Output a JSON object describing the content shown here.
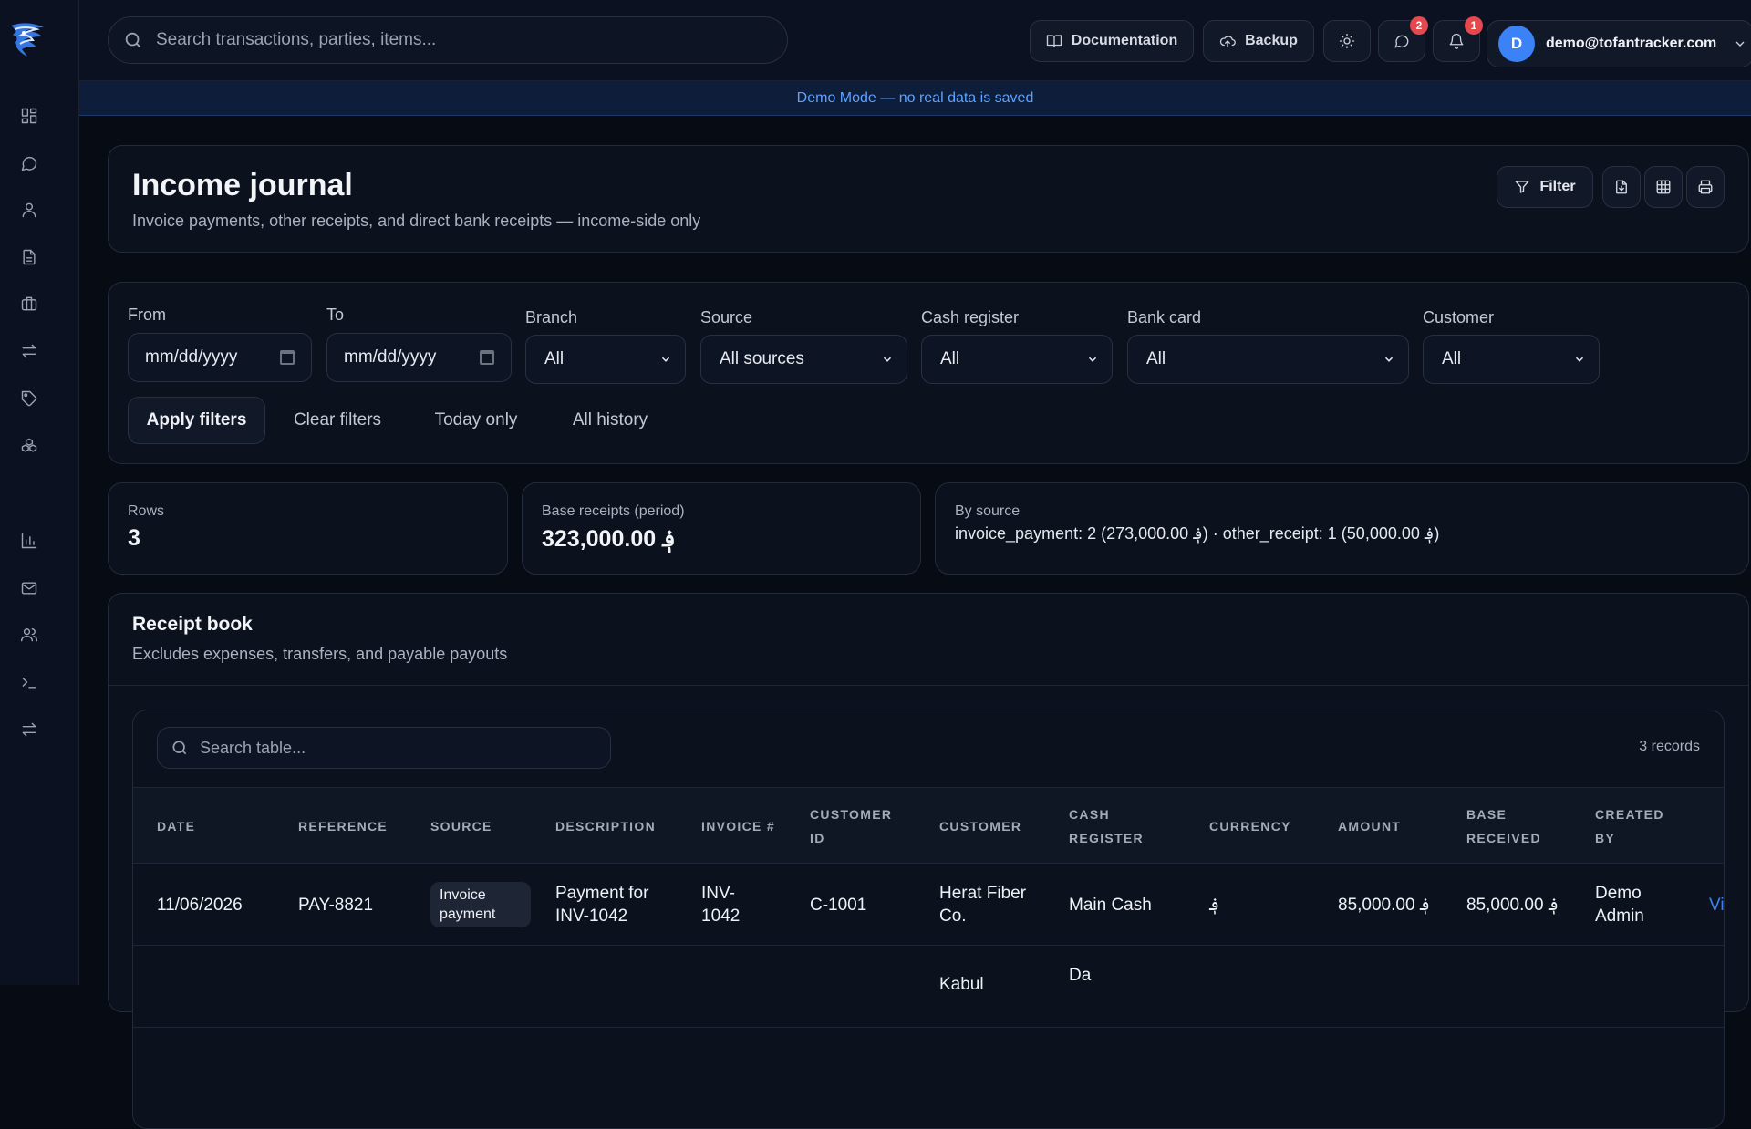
{
  "topbar": {
    "search_placeholder": "Search transactions, parties, items...",
    "documentation_label": "Documentation",
    "backup_label": "Backup",
    "messages_badge": "2",
    "notifications_badge": "1",
    "user_initial": "D",
    "user_email": "demo@tofantracker.com"
  },
  "demo_banner": "Demo Mode — no real data is saved",
  "header": {
    "title": "Income journal",
    "subtitle": "Invoice payments, other receipts, and direct bank receipts — income-side only",
    "filter_label": "Filter"
  },
  "filters": {
    "from_label": "From",
    "from_value": "mm/dd/yyyy",
    "to_label": "To",
    "to_value": "mm/dd/yyyy",
    "branch_label": "Branch",
    "branch_value": "All",
    "source_label": "Source",
    "source_value": "All sources",
    "cash_register_label": "Cash register",
    "cash_register_value": "All",
    "bank_card_label": "Bank card",
    "bank_card_value": "All",
    "customer_label": "Customer",
    "customer_value": "All",
    "apply_label": "Apply filters",
    "clear_label": "Clear filters",
    "today_label": "Today only",
    "history_label": "All history"
  },
  "stats": {
    "rows_label": "Rows",
    "rows_value": "3",
    "base_label": "Base receipts (period)",
    "base_value": "323,000.00 ؋",
    "source_label": "By source",
    "source_value": "invoice_payment: 2 (273,000.00 ؋) · other_receipt: 1 (50,000.00 ؋)"
  },
  "receipt_book": {
    "title": "Receipt book",
    "subtitle": "Excludes expenses, transfers, and payable payouts",
    "search_placeholder": "Search table...",
    "records": "3 records"
  },
  "table": {
    "headers": [
      "DATE",
      "REFERENCE",
      "SOURCE",
      "DESCRIPTION",
      "INVOICE #",
      "CUSTOMER ID",
      "CUSTOMER",
      "CASH REGISTER",
      "CURRENCY",
      "AMOUNT",
      "BASE RECEIVED",
      "CREATED BY"
    ],
    "rows": [
      {
        "date": "11/06/2026",
        "reference": "PAY-8821",
        "source": "Invoice payment",
        "description": "Payment for INV-1042",
        "invoice": "INV-1042",
        "customer_id": "C-1001",
        "customer": "Herat Fiber Co.",
        "cash_register": "Main Cash",
        "currency": "؋",
        "amount": "85,000.00 ؋",
        "base_received": "85,000.00 ؋",
        "created_by": "Demo Admin",
        "action": "Vi"
      },
      {
        "customer": "Kabul",
        "cash_register": "Da"
      }
    ]
  }
}
